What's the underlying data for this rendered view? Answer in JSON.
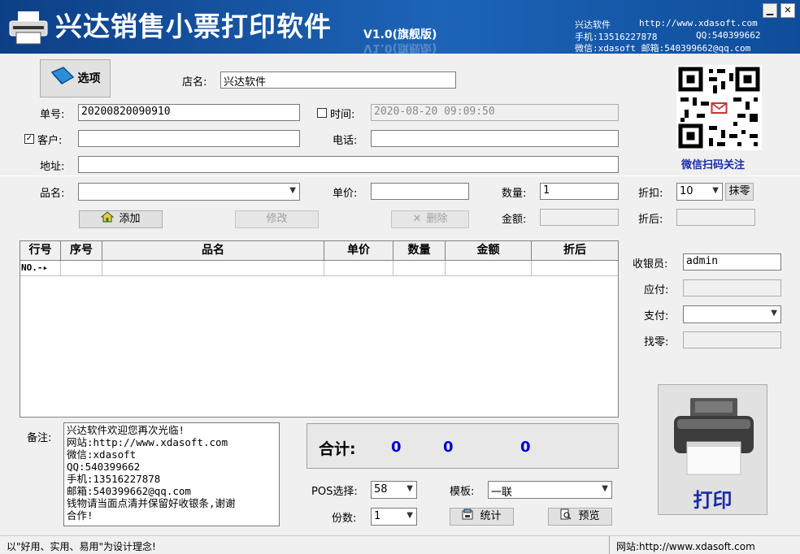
{
  "header": {
    "title": "兴达销售小票打印软件",
    "version": "V1.0(旗舰版)",
    "info": [
      {
        "label": "兴达软件",
        "value": "http://www.xdasoft.com"
      },
      {
        "label": "手机:13516227878",
        "value": "QQ:540399662"
      },
      {
        "label": "微信:xdasoft 邮箱:540399662@qq.com",
        "value": ""
      }
    ]
  },
  "window": {
    "minimize": "▁",
    "close": "✕"
  },
  "top_form": {
    "options_button": "选项",
    "shop_label": "店名:",
    "shop_value": "兴达软件",
    "order_label": "单号:",
    "order_value": "20200820090910",
    "time_label": "时间:",
    "time_value": "2020-08-20 09:09:50",
    "customer_label": "客户:",
    "customer_value": "",
    "phone_label": "电话:",
    "phone_value": "",
    "address_label": "地址:",
    "address_value": "",
    "qr_caption": "微信扫码关注"
  },
  "item_form": {
    "name_label": "品名:",
    "name_value": "",
    "price_label": "单价:",
    "price_value": "",
    "qty_label": "数量:",
    "qty_value": "1",
    "discount_label": "折扣:",
    "discount_value": "10",
    "round_button": "抹零",
    "amount_label": "金额:",
    "amount_value": "",
    "after_discount_label": "折后:",
    "after_discount_value": "",
    "add_button": "添加",
    "edit_button": "修改",
    "delete_button": "删除"
  },
  "grid": {
    "columns": [
      "行号",
      "序号",
      "品名",
      "单价",
      "数量",
      "金额",
      "折后"
    ],
    "first_row_marker": "NO.-▸"
  },
  "payment": {
    "cashier_label": "收银员:",
    "cashier_value": "admin",
    "due_label": "应付:",
    "due_value": "",
    "paid_label": "支付:",
    "paid_value": "",
    "change_label": "找零:",
    "change_value": ""
  },
  "notes": {
    "label": "备注:",
    "lines": [
      "兴达软件欢迎您再次光临!",
      "网站:http://www.xdasoft.com",
      "微信:xdasoft",
      "QQ:540399662",
      "手机:13516227878",
      "邮箱:540399662@qq.com",
      "钱物请当面点清并保留好收银条,谢谢",
      "合作!"
    ]
  },
  "totals": {
    "label": "合计:",
    "quantity": "0",
    "amount": "0",
    "after_discount": "0"
  },
  "print_settings": {
    "pos_label": "POS选择:",
    "pos_value": "58",
    "template_label": "模板:",
    "template_value": "一联",
    "copies_label": "份数:",
    "copies_value": "1",
    "stats_button": "统计",
    "preview_button": "预览",
    "print_button": "打印"
  },
  "status_bar": {
    "left": "以\"好用、实用、易用\"为设计理念!",
    "right": "网站:http://www.xdasoft.com"
  },
  "colors": {
    "header": "#1d64b8",
    "totals_text": "#0000cc",
    "print_text": "#1a2ca8",
    "qr_caption": "#1a2ca8"
  }
}
